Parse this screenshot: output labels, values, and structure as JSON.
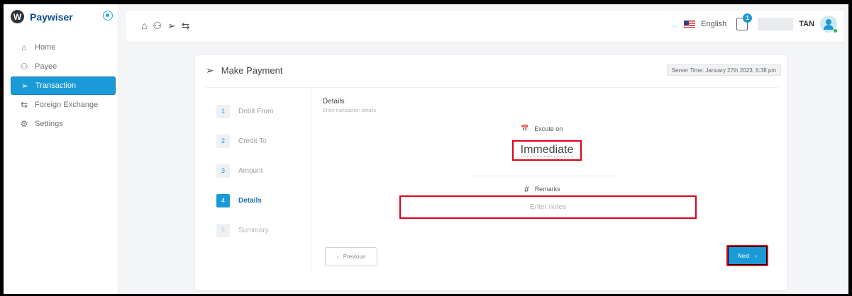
{
  "app": {
    "brand": "Paywiser",
    "logo_letter": "W"
  },
  "sidebar": {
    "items": [
      {
        "label": "Home",
        "icon": "home-icon",
        "glyph": "⌂",
        "active": false
      },
      {
        "label": "Payee",
        "icon": "payee-icon",
        "glyph": "⚇",
        "active": false
      },
      {
        "label": "Transaction",
        "icon": "send-icon",
        "glyph": "➢",
        "active": true
      },
      {
        "label": "Foreign Exchange",
        "icon": "exchange-icon",
        "glyph": "⇆",
        "active": false
      },
      {
        "label": "Settings",
        "icon": "gear-icon",
        "glyph": "⚙",
        "active": false
      }
    ]
  },
  "topbar": {
    "quick_icons": [
      "home-icon",
      "payee-icon",
      "send-icon",
      "exchange-icon"
    ],
    "language": "English",
    "notification_count": "1",
    "user_name": "TAN"
  },
  "payment": {
    "title": "Make Payment",
    "server_time": "Server Time: January 27th 2023, 5:38 pm",
    "steps": [
      {
        "num": "1",
        "label": "Debit From",
        "state": "done"
      },
      {
        "num": "2",
        "label": "Credit To",
        "state": "done"
      },
      {
        "num": "3",
        "label": "Amount",
        "state": "done"
      },
      {
        "num": "4",
        "label": "Details",
        "state": "active"
      },
      {
        "num": "5",
        "label": "Summary",
        "state": "disabled"
      }
    ],
    "details_title": "Details",
    "details_subtitle": "Enter transaction details",
    "execute_label": "Excute on",
    "execute_value": "Immediate",
    "remarks_label": "Remarks",
    "remarks_placeholder": "Enter notes",
    "remarks_value": "",
    "previous_label": "Previous",
    "next_label": "Next"
  },
  "colors": {
    "accent": "#1a9ad6",
    "brand": "#0d4f8c",
    "highlight": "#e0001a",
    "online": "#2db54a"
  }
}
